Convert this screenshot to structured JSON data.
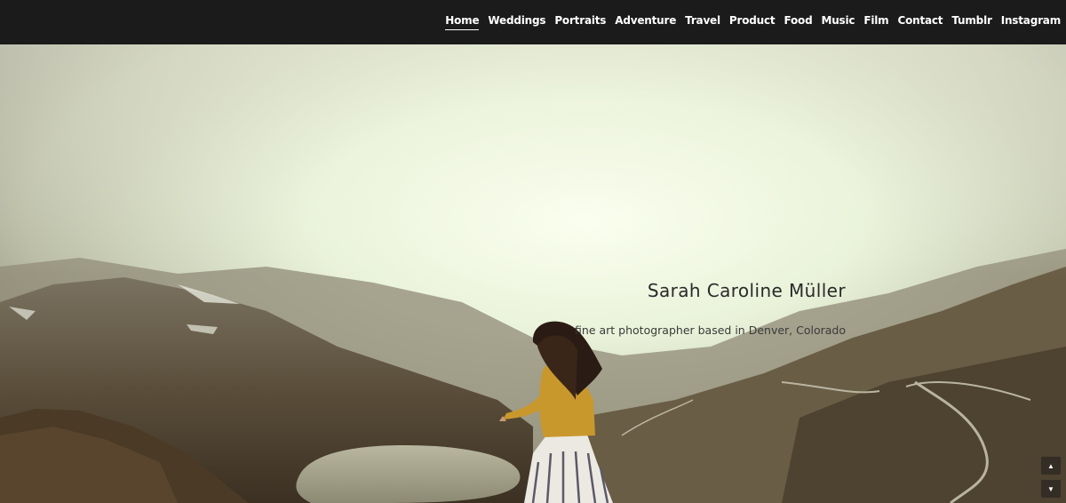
{
  "nav": {
    "items": [
      {
        "label": "Home",
        "active": true
      },
      {
        "label": "Weddings"
      },
      {
        "label": "Portraits"
      },
      {
        "label": "Adventure"
      },
      {
        "label": "Travel"
      },
      {
        "label": "Product"
      },
      {
        "label": "Food"
      },
      {
        "label": "Music"
      },
      {
        "label": "Film"
      },
      {
        "label": "Contact"
      },
      {
        "label": "Tumblr"
      },
      {
        "label": "Instagram"
      }
    ]
  },
  "hero": {
    "title": "Sarah Caroline Müller",
    "subtitle": "fine art photographer based in Denver, Colorado",
    "image_description": "woman in yellow sweater and striped skirt on misty mountain overlook with lake and winding road"
  },
  "scroll": {
    "up_icon": "▲",
    "down_icon": "▼"
  },
  "colors": {
    "navbar": "#1b1b1b",
    "nav_text": "#ffffff",
    "title_text": "#2a2a2a"
  }
}
